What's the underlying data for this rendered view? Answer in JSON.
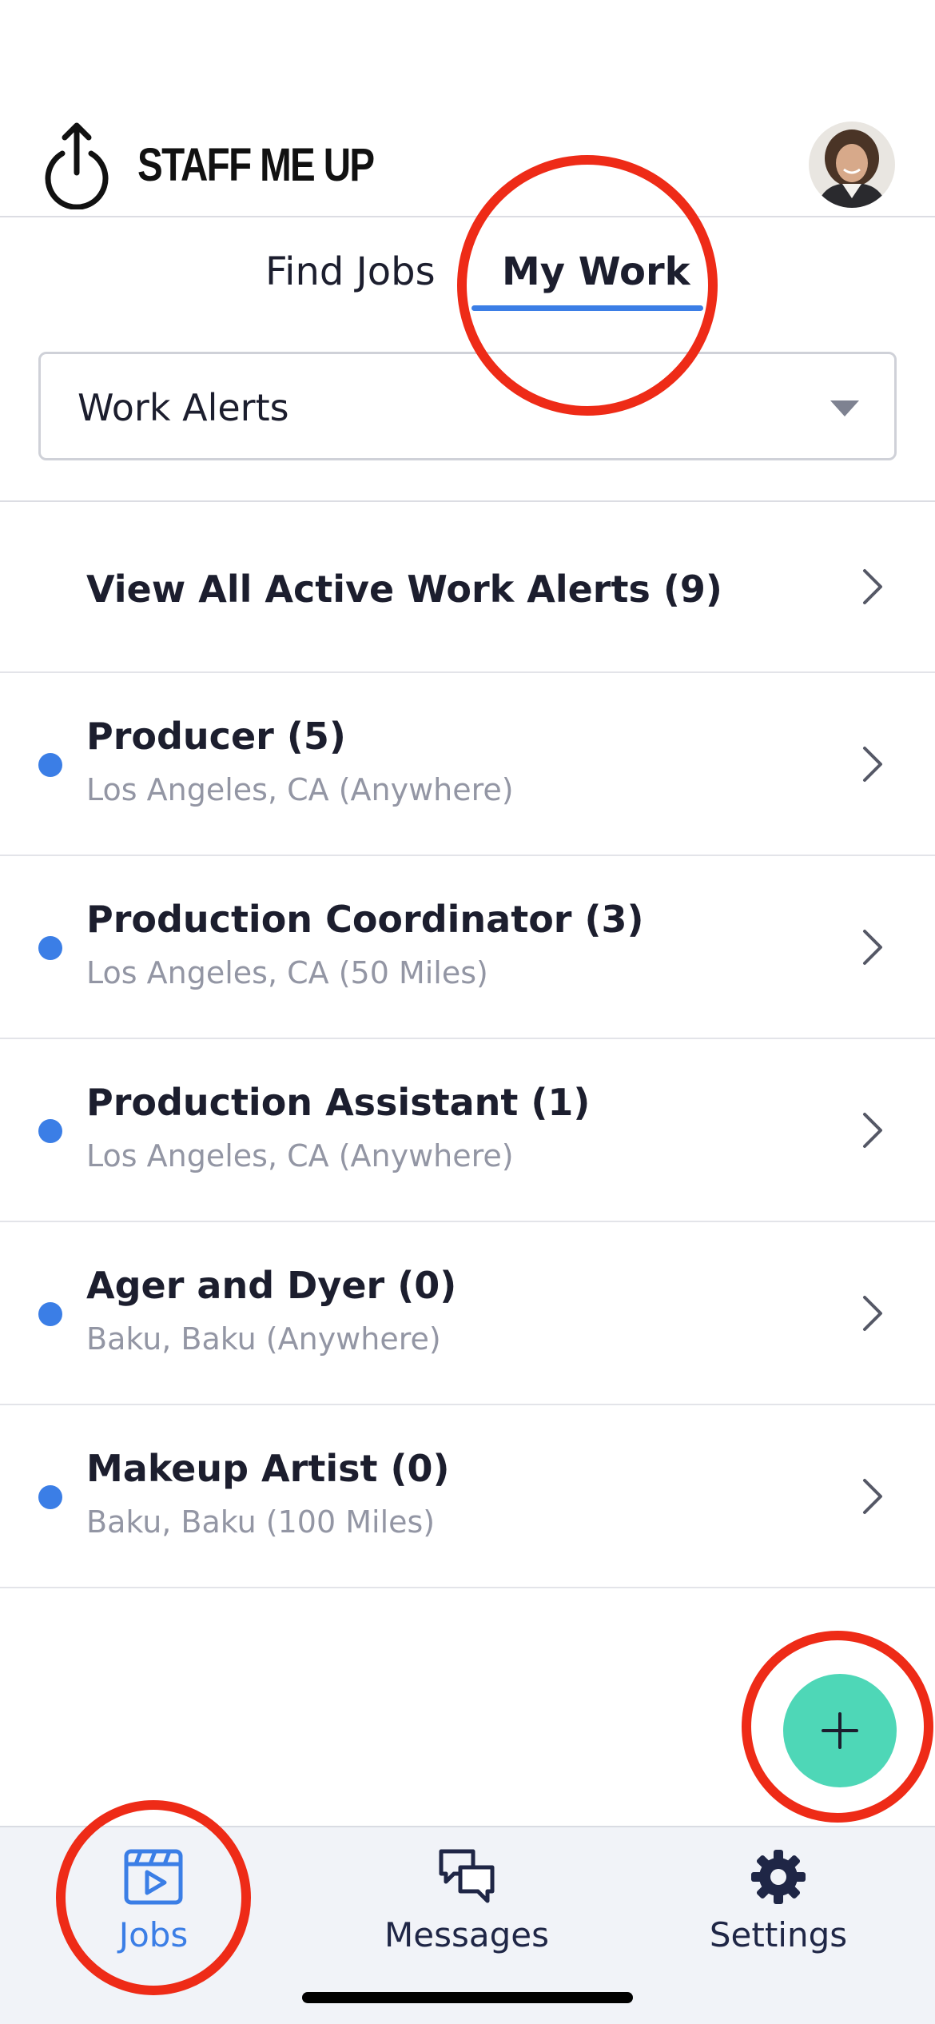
{
  "app": {
    "brand": "STAFF ME UP"
  },
  "tabs": {
    "find_jobs": "Find Jobs",
    "my_work": "My Work",
    "active": "My Work"
  },
  "filter": {
    "selected": "Work Alerts"
  },
  "list": {
    "view_all": "View All Active Work Alerts (9)",
    "alerts": [
      {
        "title": "Producer (5)",
        "location": "Los Angeles, CA (Anywhere)"
      },
      {
        "title": "Production Coordinator (3)",
        "location": "Los Angeles, CA (50 Miles)"
      },
      {
        "title": "Production Assistant (1)",
        "location": "Los Angeles, CA (Anywhere)"
      },
      {
        "title": "Ager and Dyer (0)",
        "location": "Baku, Baku (Anywhere)"
      },
      {
        "title": "Makeup Artist (0)",
        "location": "Baku, Baku (100 Miles)"
      }
    ]
  },
  "bottom_nav": {
    "jobs": "Jobs",
    "messages": "Messages",
    "settings": "Settings",
    "active": "Jobs"
  },
  "icons": {
    "brand": "power-upload-icon",
    "add": "plus-icon",
    "jobs": "clapperboard-play-icon",
    "messages": "chat-bubbles-icon",
    "settings": "gear-icon"
  },
  "colors": {
    "accent_blue": "#3b7ee6",
    "fab_teal": "#4ed7b7",
    "highlight_red": "#ee2b17",
    "subtext_gray": "#9396a4",
    "nav_dark": "#1f2646"
  }
}
